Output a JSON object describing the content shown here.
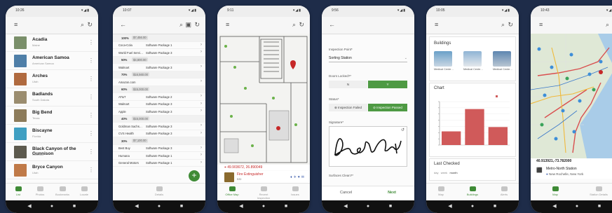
{
  "phone1": {
    "status_time": "10:26",
    "parks": [
      {
        "name": "Acadia",
        "state": "Maine"
      },
      {
        "name": "American Samoa",
        "state": "American Samoa"
      },
      {
        "name": "Arches",
        "state": "Utah"
      },
      {
        "name": "Badlands",
        "state": "South Dakota"
      },
      {
        "name": "Big Bend",
        "state": "Texas"
      },
      {
        "name": "Biscayne",
        "state": "Florida"
      },
      {
        "name": "Black Canyon of the Gunnison",
        "state": "Colorado"
      },
      {
        "name": "Bryce Canyon",
        "state": "Utah"
      }
    ],
    "nav": [
      "List",
      "Photos",
      "Bookmarks",
      "Locate"
    ]
  },
  "phone2": {
    "status_time": "10:07",
    "rows": [
      {
        "type": "header",
        "pct": "100%",
        "amt": "$7,456.00"
      },
      {
        "type": "row",
        "company": "Coca-Cola",
        "product": "Software Package 1"
      },
      {
        "type": "row",
        "company": "World Fuel Servi…",
        "product": "Software Package 3"
      },
      {
        "type": "header",
        "pct": "50%",
        "amt": "$4,800.00"
      },
      {
        "type": "row",
        "company": "Walmart",
        "product": "Software Package 3"
      },
      {
        "type": "header",
        "pct": "70%",
        "amt": "$16,560.00"
      },
      {
        "type": "row",
        "company": "Amazon.com",
        "product": ""
      },
      {
        "type": "header",
        "pct": "60%",
        "amt": "$15,000.00"
      },
      {
        "type": "row",
        "company": "AT&T",
        "product": "Software Package 2"
      },
      {
        "type": "row",
        "company": "Walmart",
        "product": "Software Package 3"
      },
      {
        "type": "row",
        "company": "Apple",
        "product": "Software Package 3"
      },
      {
        "type": "header",
        "pct": "40%",
        "amt": "$15,000.00"
      },
      {
        "type": "row",
        "company": "Goldman Sachs…",
        "product": "Software Package 3"
      },
      {
        "type": "row",
        "company": "CVS Health",
        "product": "Software Package 3"
      },
      {
        "type": "header",
        "pct": "30%",
        "amt": "$7,100.00"
      },
      {
        "type": "row",
        "company": "Best Buy",
        "product": "Software Package 3"
      },
      {
        "type": "row",
        "company": "Humana",
        "product": "Software Package 1"
      },
      {
        "type": "row",
        "company": "General Motors",
        "product": "Software Package 1"
      }
    ],
    "nav": "Details"
  },
  "phone3": {
    "status_time": "9:11",
    "coords": "49.903672, 26.890049",
    "card_title": "Fire Extinguisher",
    "card_sub": "BSI",
    "nav": [
      "Office Map",
      "Recent Inspection",
      "Issues"
    ]
  },
  "phone4": {
    "status_time": "9:56",
    "label_inspection_point": "Inspection Point*",
    "value_inspection_point": "Sorting Station",
    "label_doors": "Doors Locked?*",
    "btn_no": "N",
    "btn_yes": "Y",
    "label_status": "Status*",
    "btn_failed": "Inspection Failed",
    "btn_passed": "Inspection Passed",
    "label_signature": "Signature*",
    "label_surfaces": "Surfaces Clean?*",
    "cancel": "Cancel",
    "next": "Next"
  },
  "phone5": {
    "status_time": "10:05",
    "buildings_title": "Buildings",
    "buildings": [
      "Medical Cente…",
      "Medical Cente…",
      "Medical Cente…"
    ],
    "chart_title": "Chart",
    "last_checked": "Last Checked",
    "filters": [
      "day",
      "week",
      "month"
    ],
    "nav": [
      "Map",
      "Buildings",
      "Alerts"
    ],
    "colors": {
      "bar": "#d05a5a"
    }
  },
  "phone6": {
    "status_time": "10:43",
    "coords": "40.913921,-73.782000",
    "station_name": "Metro-North Station",
    "station_city": "New Rochelle, New York",
    "nav": [
      "Map",
      "Station Details"
    ]
  },
  "chart_data": {
    "type": "bar",
    "categories": [
      "",
      "",
      ""
    ],
    "values": [
      22,
      58,
      29
    ],
    "ylim": [
      0,
      70
    ],
    "series": [
      {
        "name": "",
        "values": [
          22,
          58,
          29
        ]
      }
    ],
    "legend": "top-right"
  }
}
